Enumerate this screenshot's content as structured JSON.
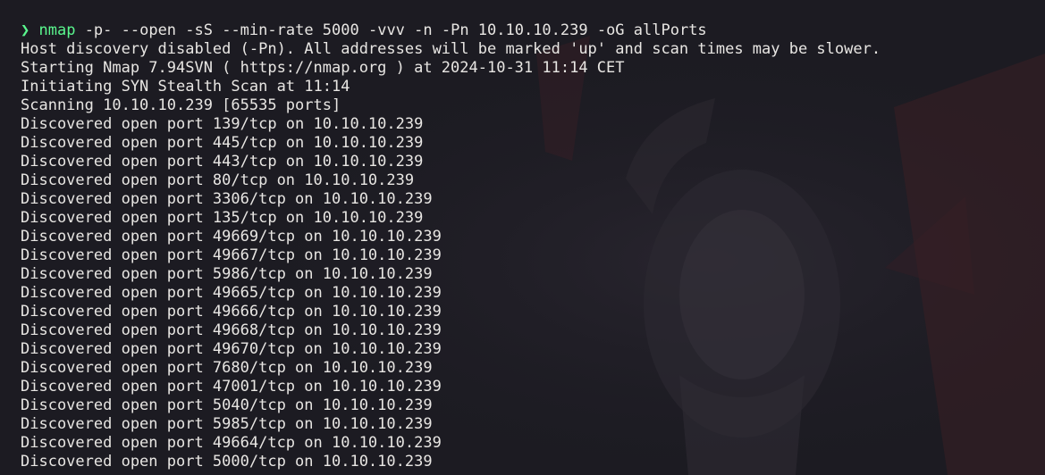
{
  "terminal": {
    "prompt_symbol": "❯",
    "command": "nmap",
    "command_args": " -p- --open -sS --min-rate 5000 -vvv -n -Pn 10.10.10.239 -oG allPorts",
    "output_lines": [
      "Host discovery disabled (-Pn). All addresses will be marked 'up' and scan times may be slower.",
      "Starting Nmap 7.94SVN ( https://nmap.org ) at 2024-10-31 11:14 CET",
      "Initiating SYN Stealth Scan at 11:14",
      "Scanning 10.10.10.239 [65535 ports]",
      "Discovered open port 139/tcp on 10.10.10.239",
      "Discovered open port 445/tcp on 10.10.10.239",
      "Discovered open port 443/tcp on 10.10.10.239",
      "Discovered open port 80/tcp on 10.10.10.239",
      "Discovered open port 3306/tcp on 10.10.10.239",
      "Discovered open port 135/tcp on 10.10.10.239",
      "Discovered open port 49669/tcp on 10.10.10.239",
      "Discovered open port 49667/tcp on 10.10.10.239",
      "Discovered open port 5986/tcp on 10.10.10.239",
      "Discovered open port 49665/tcp on 10.10.10.239",
      "Discovered open port 49666/tcp on 10.10.10.239",
      "Discovered open port 49668/tcp on 10.10.10.239",
      "Discovered open port 49670/tcp on 10.10.10.239",
      "Discovered open port 7680/tcp on 10.10.10.239",
      "Discovered open port 47001/tcp on 10.10.10.239",
      "Discovered open port 5040/tcp on 10.10.10.239",
      "Discovered open port 5985/tcp on 10.10.10.239",
      "Discovered open port 49664/tcp on 10.10.10.239",
      "Discovered open port 5000/tcp on 10.10.10.239"
    ]
  },
  "colors": {
    "background": "#1c1b22",
    "text": "#e8e6e3",
    "prompt_green": "#5af78e",
    "wallpaper_red": "#3a1f25"
  },
  "icons": {
    "prompt": "chevron-right-icon"
  }
}
